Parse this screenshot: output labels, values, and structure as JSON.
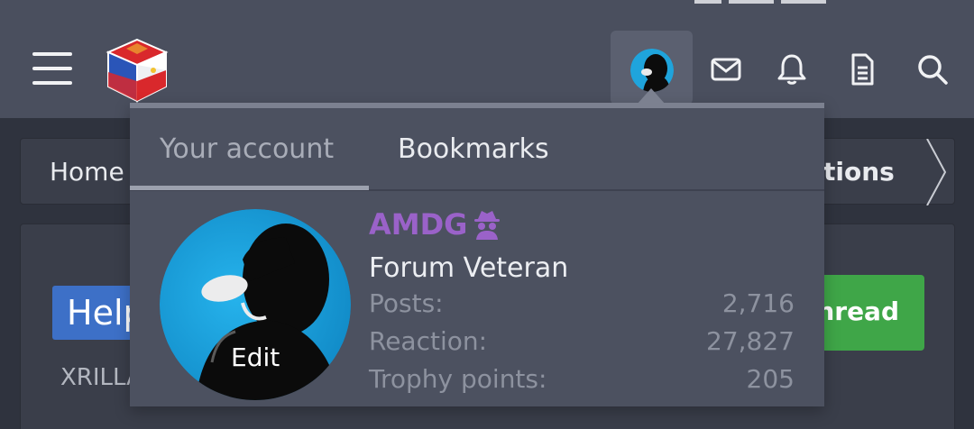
{
  "header": {
    "menu_icon": "hamburger-icon",
    "logo_icon": "philippines-cube-logo",
    "icons": [
      "envelope-icon",
      "bell-icon",
      "document-icon",
      "search-icon"
    ]
  },
  "breadcrumb": {
    "home": "Home",
    "current": "tions"
  },
  "content": {
    "badge": "Help",
    "subtext": "XRILLA",
    "post_button": "hread"
  },
  "dropdown": {
    "tabs": [
      "Your account",
      "Bookmarks"
    ],
    "active_tab": "Your account",
    "username": "AMDG",
    "username_color": "#9a62c9",
    "user_title": "Forum Veteran",
    "avatar_edit": "Edit",
    "stats": [
      {
        "label": "Posts:",
        "value": "2,716"
      },
      {
        "label": "Reaction:",
        "value": "27,827"
      },
      {
        "label": "Trophy points:",
        "value": "205"
      }
    ]
  }
}
